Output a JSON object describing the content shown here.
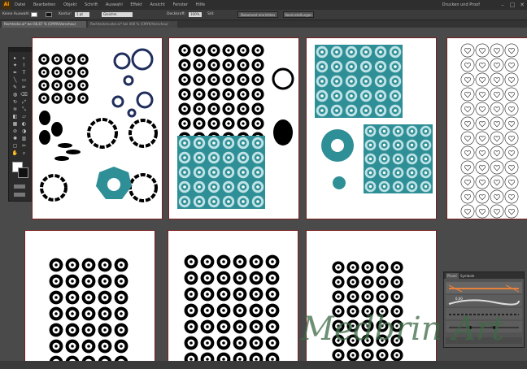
{
  "app": {
    "logo": "Ai",
    "workspace_label": "Drucken und Proof"
  },
  "menu": [
    "Datei",
    "Bearbeiten",
    "Objekt",
    "Schrift",
    "Auswahl",
    "Effekt",
    "Ansicht",
    "Fenster",
    "Hilfe"
  ],
  "window_controls": {
    "minimize": "–",
    "maximize": "□",
    "close": "✕"
  },
  "control_bar": {
    "selection": "Keine Auswahl",
    "stroke_label": "Kontur:",
    "stroke_value": "1 pt",
    "brush_value": "Gleichm.",
    "opacity_label": "Deckkraft:",
    "opacity_value": "100%",
    "style_label": "Stil:",
    "doc_setup_button": "Dokument einrichten",
    "preferences_button": "Voreinstellungen"
  },
  "tabs": [
    {
      "label": "Rechtecke.ai* bei 66,67 % (CMYK/Vorschau)",
      "active": true
    },
    {
      "label": "Rechteckmuster.ai* bei 400 % (CMYK/Vorschau)",
      "active": false
    }
  ],
  "tools": [
    "selection-tool",
    "direct-selection-tool",
    "magic-wand-tool",
    "lasso-tool",
    "pen-tool",
    "type-tool",
    "line-tool",
    "rectangle-tool",
    "brush-tool",
    "pencil-tool",
    "blob-brush-tool",
    "eraser-tool",
    "rotate-tool",
    "scale-tool",
    "width-tool",
    "free-transform-tool",
    "shape-builder-tool",
    "perspective-tool",
    "mesh-tool",
    "gradient-tool",
    "eyedropper-tool",
    "blend-tool",
    "symbol-sprayer-tool",
    "graph-tool",
    "artboard-tool",
    "slice-tool",
    "hand-tool",
    "zoom-tool"
  ],
  "panel": {
    "tabs": [
      "Pinsel",
      "Symbole"
    ],
    "size_value": "6,00"
  },
  "colors": {
    "accent_teal": "#2f8f96",
    "navy": "#1f2e5c",
    "artboard_border": "#7a1f1f",
    "watermark": "#3d6a45"
  },
  "watermark": "Medbrin Art"
}
